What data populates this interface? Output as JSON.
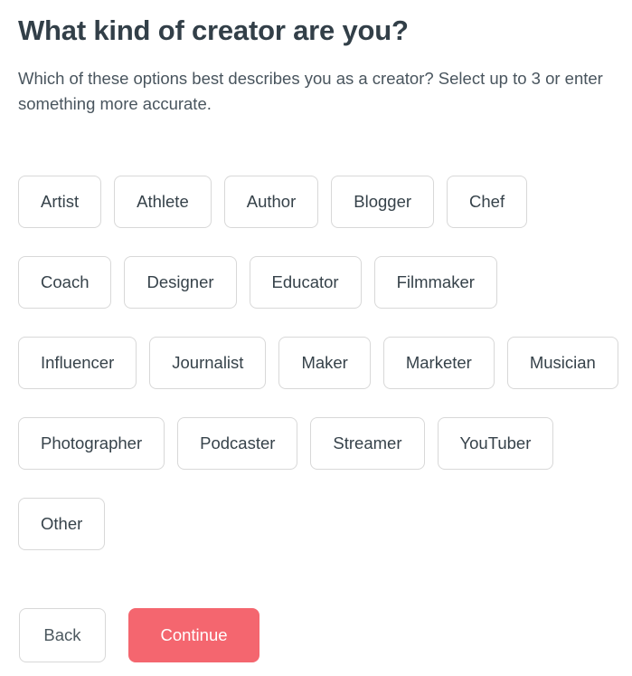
{
  "header": {
    "title": "What kind of creator are you?",
    "subtitle": "Which of these options best describes you as a creator? Select up to 3 or enter something more accurate."
  },
  "options": [
    {
      "label": "Artist",
      "selected": false
    },
    {
      "label": "Athlete",
      "selected": false
    },
    {
      "label": "Author",
      "selected": false
    },
    {
      "label": "Blogger",
      "selected": false
    },
    {
      "label": "Chef",
      "selected": false
    },
    {
      "label": "Coach",
      "selected": false
    },
    {
      "label": "Designer",
      "selected": false
    },
    {
      "label": "Educator",
      "selected": false
    },
    {
      "label": "Filmmaker",
      "selected": false
    },
    {
      "label": "Influencer",
      "selected": false
    },
    {
      "label": "Journalist",
      "selected": false
    },
    {
      "label": "Maker",
      "selected": false
    },
    {
      "label": "Marketer",
      "selected": false
    },
    {
      "label": "Musician",
      "selected": false
    },
    {
      "label": "Photographer",
      "selected": false
    },
    {
      "label": "Podcaster",
      "selected": false
    },
    {
      "label": "Streamer",
      "selected": false
    },
    {
      "label": "YouTuber",
      "selected": false
    },
    {
      "label": "Other",
      "selected": false
    }
  ],
  "actions": {
    "back_label": "Back",
    "continue_label": "Continue"
  },
  "colors": {
    "accent": "#f4666f",
    "heading_text": "#323f48",
    "body_text": "#49555e",
    "chip_border": "#d8d8d8",
    "background": "#ffffff"
  }
}
